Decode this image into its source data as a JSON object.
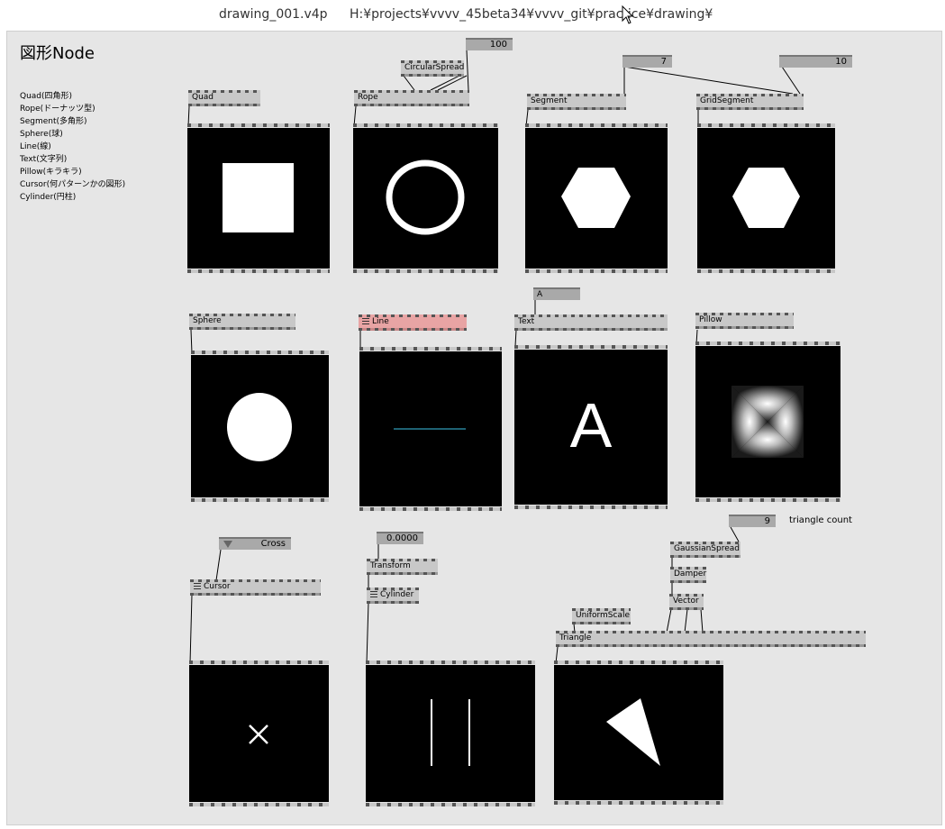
{
  "window": {
    "file_name": "drawing_001.v4p",
    "path": "H:¥projects¥vvvv_45beta34¥vvvv_git¥practice¥drawing¥"
  },
  "heading": "図形Node",
  "notes": [
    "Quad(四角形)",
    "Rope(ドーナッツ型)",
    "Segment(多角形)",
    "Sphere(球)",
    "Line(線)",
    "Text(文字列)",
    "Pillow(キラキラ)",
    "Cursor(何パターンかの図形)",
    "Cylinder(円柱)"
  ],
  "nodes": {
    "quad": "Quad",
    "rope": "Rope",
    "circular_spread": "CircularSpread",
    "segment": "Segment",
    "grid_segment": "GridSegment",
    "sphere": "Sphere",
    "line": "Line",
    "text": "Text",
    "pillow": "Pillow",
    "cursor": "Cursor",
    "transform": "Transform",
    "cylinder": "Cylinder",
    "gaussian_spread": "GaussianSpread",
    "damper": "Damper",
    "vector": "Vector",
    "uniform_scale": "UniformScale",
    "triangle": "Triangle"
  },
  "iobox": {
    "rope_res": "100",
    "segment_res": "7",
    "grid_res": "10",
    "text_string": "A",
    "cursor_type": "Cross",
    "transform_val": "0.0000",
    "triangle_count": "9"
  },
  "labels": {
    "triangle_count": "triangle count",
    "text_render": "A"
  },
  "colors": {
    "patch_bg": "#e6e6e6",
    "node_gray": "#c8c8c8",
    "line_cyan": "#3cc4e6",
    "line_node_red": "#e8a4a4"
  }
}
